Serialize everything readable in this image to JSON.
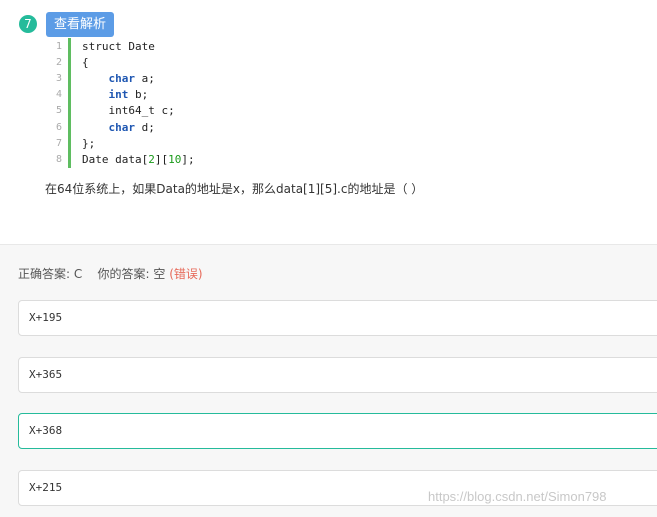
{
  "question": {
    "number": "7",
    "analysis_button": "查看解析",
    "code_lines": [
      {
        "num": "1",
        "text": "struct Date"
      },
      {
        "num": "2",
        "text": "{"
      },
      {
        "num": "3",
        "text": "    char a;"
      },
      {
        "num": "4",
        "text": "    int b;"
      },
      {
        "num": "5",
        "text": "    int64_t c;"
      },
      {
        "num": "6",
        "text": "    char d;"
      },
      {
        "num": "7",
        "text": "};"
      },
      {
        "num": "8",
        "text": "Date data[2][10];"
      }
    ],
    "text": "在64位系统上，如果Data的地址是x，那么data[1][5].c的地址是（ ）"
  },
  "answer": {
    "correct_label": "正确答案: C",
    "your_label": "你的答案: 空",
    "result": "(错误)"
  },
  "options": [
    {
      "text": "X+195"
    },
    {
      "text": "X+365"
    },
    {
      "text": "X+368"
    },
    {
      "text": "X+215"
    }
  ],
  "watermark": "https://blog.csdn.net/Simon798",
  "colors": {
    "accent": "#25bb9b",
    "button": "#5c9ce6",
    "error": "#e76a5a"
  }
}
